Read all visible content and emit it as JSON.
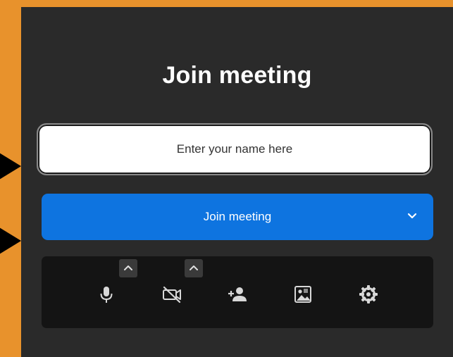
{
  "page": {
    "title": "Join meeting",
    "name_input": {
      "placeholder": "Enter your name here",
      "value": ""
    },
    "join_button": {
      "label": "Join meeting"
    },
    "toolbar": {
      "buttons": [
        {
          "name": "microphone",
          "icon": "microphone-icon",
          "has_options": true
        },
        {
          "name": "camera",
          "icon": "camera-off-icon",
          "has_options": true
        },
        {
          "name": "invite",
          "icon": "add-person-icon",
          "has_options": false
        },
        {
          "name": "background",
          "icon": "background-image-icon",
          "has_options": false
        },
        {
          "name": "settings",
          "icon": "gear-icon",
          "has_options": false
        }
      ]
    }
  },
  "colors": {
    "outer_background": "#e8922c",
    "panel_background": "#2a2a2a",
    "primary_button": "#0e74e0",
    "toolbar_background": "#141414",
    "annotation_arrows": "#000000"
  }
}
